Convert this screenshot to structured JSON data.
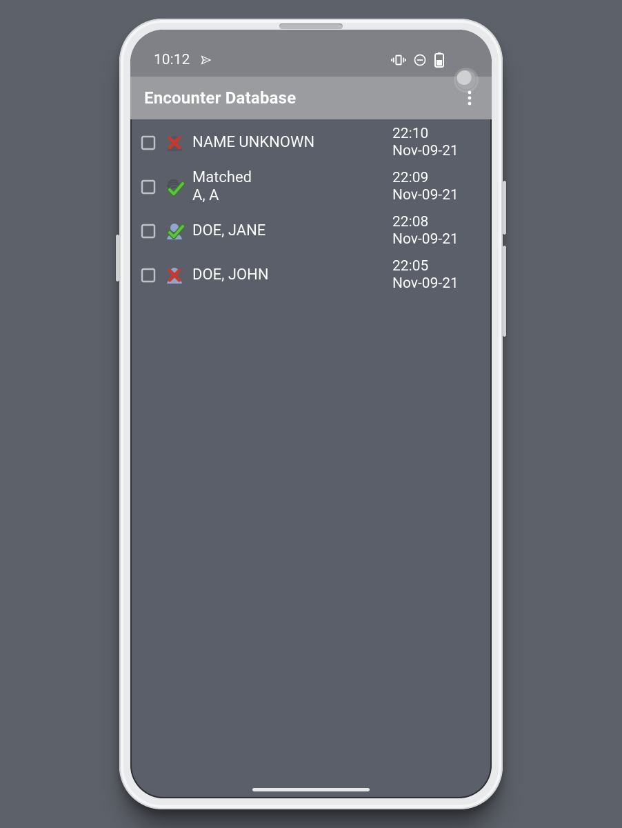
{
  "statusbar": {
    "time": "10:12",
    "left_icons": [
      "send-icon"
    ],
    "right_icons": [
      "vibrate-icon",
      "dnd-icon",
      "battery-icon"
    ]
  },
  "appbar": {
    "title": "Encounter Database"
  },
  "rows": [
    {
      "status": "unknown-red",
      "line1": "NAME UNKNOWN",
      "line2": "",
      "time": "22:10",
      "date": "Nov-09-21"
    },
    {
      "status": "fingerprint-match",
      "line1": "Matched",
      "line2": "A, A",
      "time": "22:09",
      "date": "Nov-09-21"
    },
    {
      "status": "person-match",
      "line1": "DOE, JANE",
      "line2": "",
      "time": "22:08",
      "date": "Nov-09-21"
    },
    {
      "status": "person-unknown-red",
      "line1": "DOE, JOHN",
      "line2": "",
      "time": "22:05",
      "date": "Nov-09-21"
    }
  ]
}
